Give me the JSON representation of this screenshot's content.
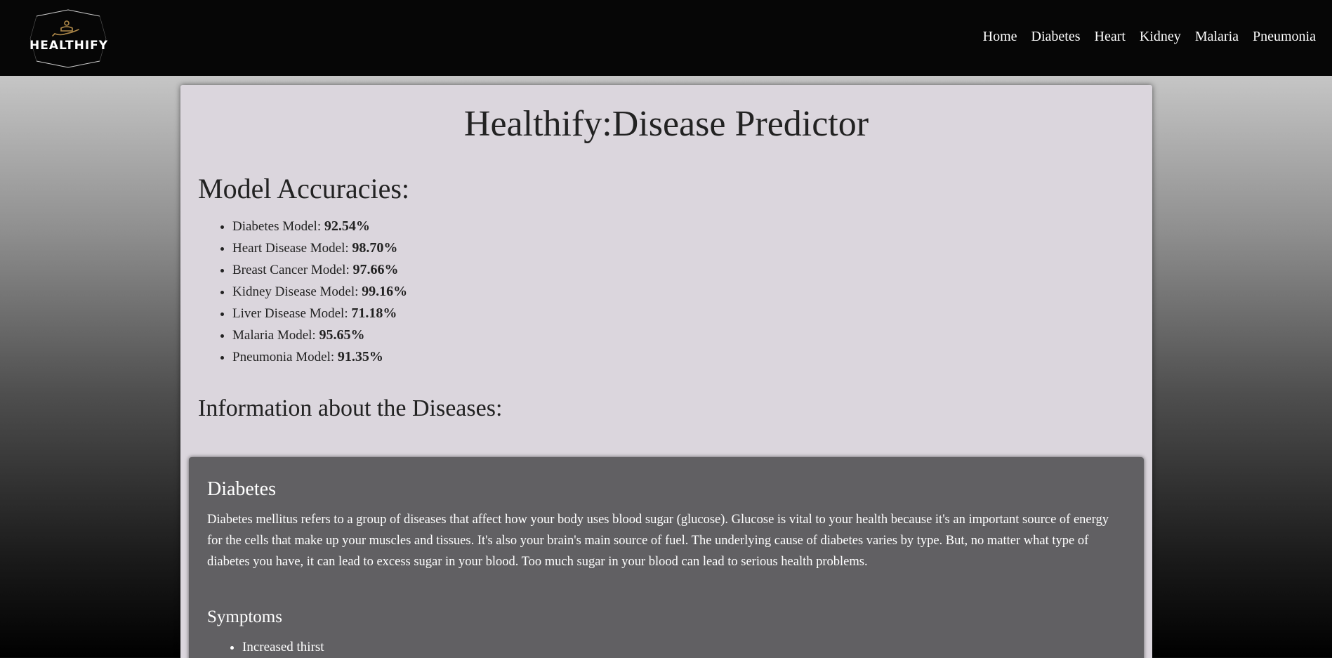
{
  "brand": {
    "name": "HEALTHIFY",
    "accent_color": "#b08a4a"
  },
  "nav": {
    "items": [
      {
        "label": "Home"
      },
      {
        "label": "Diabetes"
      },
      {
        "label": "Heart"
      },
      {
        "label": "Kidney"
      },
      {
        "label": "Malaria"
      },
      {
        "label": "Pneumonia"
      }
    ]
  },
  "main": {
    "title": "Healthify:Disease Predictor",
    "accuracies_heading": "Model Accuracies:",
    "accuracies": [
      {
        "label": "Diabetes Model: ",
        "value": "92.54%"
      },
      {
        "label": "Heart Disease Model: ",
        "value": "98.70%"
      },
      {
        "label": "Breast Cancer Model: ",
        "value": "97.66%"
      },
      {
        "label": "Kidney Disease Model: ",
        "value": "99.16%"
      },
      {
        "label": "Liver Disease Model: ",
        "value": "71.18%"
      },
      {
        "label": "Malaria Model: ",
        "value": "95.65%"
      },
      {
        "label": "Pneumonia Model: ",
        "value": "91.35%"
      }
    ],
    "info_heading": "Information about the Diseases:",
    "diseases": [
      {
        "name": "Diabetes",
        "description": "Diabetes mellitus refers to a group of diseases that affect how your body uses blood sugar (glucose). Glucose is vital to your health because it's an important source of energy for the cells that make up your muscles and tissues. It's also your brain's main source of fuel. The underlying cause of diabetes varies by type. But, no matter what type of diabetes you have, it can lead to excess sugar in your blood. Too much sugar in your blood can lead to serious health problems.",
        "symptoms_heading": "Symptoms",
        "symptoms": [
          "Increased thirst"
        ]
      }
    ]
  }
}
